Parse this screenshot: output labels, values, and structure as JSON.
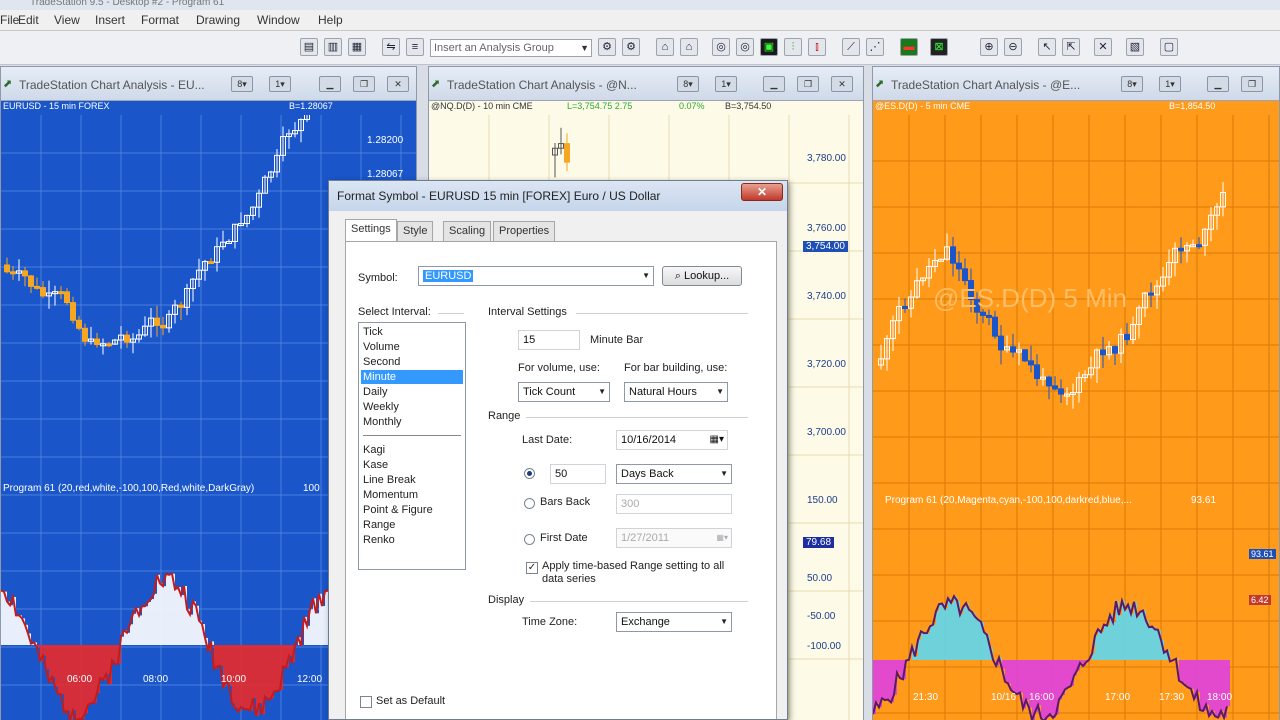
{
  "app": {
    "title": "TradeStation 9.5 - Desktop #2 - Program 61"
  },
  "menu": [
    "File",
    "Edit",
    "View",
    "Insert",
    "Format",
    "Drawing",
    "Window",
    "Help"
  ],
  "toolbar": {
    "analysis_group_placeholder": "Insert an Analysis Group"
  },
  "charts": [
    {
      "title": "TradeStation Chart Analysis - EU...",
      "info": "EURUSD - 15 min  FOREX",
      "info_right": "B=1.28067",
      "axis_labels": [
        "1.28200",
        "1.28067"
      ],
      "indicator_label": "Program 61 (20,red,white,-100,100,Red,white,DarkGray)",
      "indicator_value": "100",
      "time_labels": [
        "06:00",
        "08:00",
        "10:00",
        "12:00"
      ],
      "colors": {
        "bg": "#1a56c9",
        "up": "#ffffff",
        "down": "#f5a623"
      }
    },
    {
      "title": "TradeStation Chart Analysis - @N...",
      "info": "@NQ.D(D) - 10 min  CME",
      "info_quote": "L=3,754.75  2.75",
      "info_pct": "0.07%",
      "info_right": "B=3,754.50",
      "axis_labels": [
        "3,780.00",
        "3,760.00",
        "3,754.00",
        "3,740.00",
        "3,720.00",
        "3,700.00"
      ],
      "ind_axis_labels": [
        "150.00",
        "79.68",
        "50.00",
        "-50.00",
        "-100.00"
      ],
      "colors": {
        "bg": "#fdfbe8"
      }
    },
    {
      "title": "TradeStation Chart Analysis - @E...",
      "info": "@ES.D(D) - 5 min  CME",
      "info_right": "B=1,854.50",
      "watermark": "@ES.D(D) 5 Min",
      "indicator_label": "Program 61 (20,Magenta,cyan,-100,100,darkred,blue,...",
      "indicator_value": "93.61",
      "ind_axis_labels": [
        "93.61",
        "6.42"
      ],
      "time_labels": [
        "21:30",
        "10/16",
        "16:00",
        "17:00",
        "17:30",
        "18:00"
      ],
      "colors": {
        "bg": "#ff9a1a"
      }
    }
  ],
  "dialog": {
    "title": "Format Symbol - EURUSD 15 min [FOREX] Euro / US Dollar",
    "close": "✕",
    "tabs": [
      "Settings",
      "Style",
      "Scaling",
      "Properties"
    ],
    "symbol_label": "Symbol:",
    "symbol_value": "EURUSD",
    "lookup_label": "Lookup...",
    "select_interval_label": "Select Interval:",
    "intervals": [
      "Tick",
      "Volume",
      "Second",
      "Minute",
      "Daily",
      "Weekly",
      "Monthly"
    ],
    "selected_interval": "Minute",
    "chart_types": [
      "Kagi",
      "Kase",
      "Line Break",
      "Momentum",
      "Point & Figure",
      "Range",
      "Renko"
    ],
    "interval_settings_label": "Interval Settings",
    "interval_value": "15",
    "interval_unit": "Minute Bar",
    "for_volume_label": "For volume, use:",
    "for_volume_value": "Tick Count",
    "for_bar_label": "For bar building, use:",
    "for_bar_value": "Natural Hours",
    "range_label": "Range",
    "last_date_label": "Last Date:",
    "last_date_value": "10/16/2014",
    "days_back_value": "50",
    "days_back_unit": "Days Back",
    "bars_back_label": "Bars Back",
    "bars_back_value": "300",
    "first_date_label": "First Date",
    "first_date_value": "1/27/2011",
    "apply_label": "Apply time-based Range setting to all data series",
    "display_label": "Display",
    "timezone_label": "Time Zone:",
    "timezone_value": "Exchange",
    "set_default_label": "Set as Default"
  }
}
